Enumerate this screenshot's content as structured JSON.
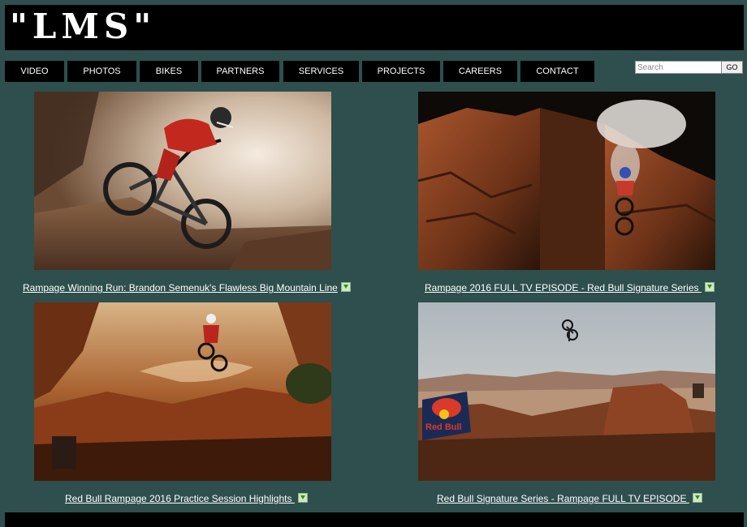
{
  "site": {
    "logo": "\"LMS\""
  },
  "nav": {
    "items": [
      "VIDEO",
      "PHOTOS",
      "BIKES",
      "PARTNERS",
      "SERVICES",
      "PROJECTS",
      "CAREERS",
      "CONTACT"
    ]
  },
  "search": {
    "placeholder": "Search",
    "button": "GO"
  },
  "videos": [
    {
      "title": "Rampage Winning Run: Brandon Semenuk's Flawless Big Mountain Line"
    },
    {
      "title": "Rampage 2016 FULL TV EPISODE - Red Bull Signature Series "
    },
    {
      "title": "Red Bull Rampage 2016 Practice Session Highlights "
    },
    {
      "title": "Red Bull Signature Series - Rampage FULL TV EPISODE "
    }
  ],
  "sponsor_sign": {
    "text": "Red Bull"
  },
  "icons": {
    "download": "download-arrow-icon"
  }
}
